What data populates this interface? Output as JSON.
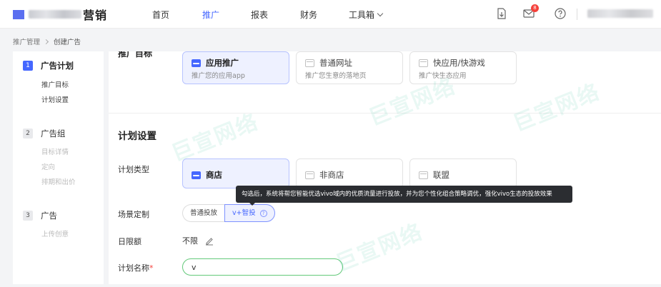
{
  "header": {
    "logo_text": "营销",
    "nav": [
      "首页",
      "推广",
      "报表",
      "财务",
      "工具箱"
    ],
    "active_nav": "推广",
    "mail_badge": "8"
  },
  "breadcrumb": [
    "推广管理",
    "创建广告"
  ],
  "steps": [
    {
      "num": "1",
      "title": "广告计划",
      "subs": [
        "推广目标",
        "计划设置"
      ]
    },
    {
      "num": "2",
      "title": "广告组",
      "subs": [
        "目标详情",
        "定向",
        "排期和出价"
      ]
    },
    {
      "num": "3",
      "title": "广告",
      "subs": [
        "上传创意"
      ]
    }
  ],
  "goal": {
    "cut_label": "推广目标",
    "cards": [
      {
        "title": "应用推广",
        "desc": "推广您的应用app"
      },
      {
        "title": "普通网址",
        "desc": "推广您生意的落地页"
      },
      {
        "title": "快应用/快游戏",
        "desc": "推广快生态应用"
      }
    ]
  },
  "plan": {
    "section_title": "计划设置",
    "type_label": "计划类型",
    "type_options": [
      "商店",
      "非商店",
      "联盟"
    ],
    "scene_label": "场景定制",
    "scene_options": [
      "普通投放",
      "v+智投"
    ],
    "tooltip": "勾选后，系统将帮您智能优选vivo域内的优质流量进行投放，并为您个性化组合策略调优，强化vivo生态的投放效果",
    "limit_label": "日限额",
    "limit_value": "不限",
    "name_label": "计划名称",
    "name_required_mark": "*",
    "name_value": "v"
  },
  "watermark": "巨宣网络",
  "colors": {
    "accent": "#4567ff",
    "success_border": "#63c97a",
    "badge": "#f5413b"
  }
}
